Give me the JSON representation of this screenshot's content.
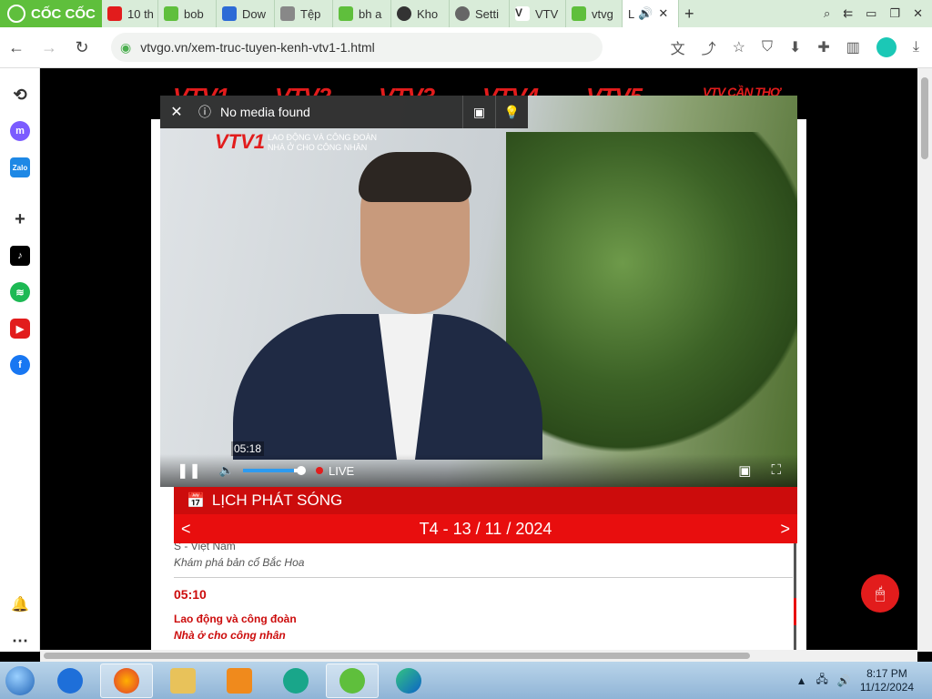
{
  "browser": {
    "name": "CỐC CỐC",
    "tabs": [
      {
        "label": "10 th",
        "icon": "youtube-icon"
      },
      {
        "label": "bob",
        "icon": "coccoc-icon"
      },
      {
        "label": "Dow",
        "icon": "download-icon"
      },
      {
        "label": "Tệp",
        "icon": "file-icon"
      },
      {
        "label": "bh a",
        "icon": "coccoc-icon"
      },
      {
        "label": "Kho",
        "icon": "github-icon"
      },
      {
        "label": "Setti",
        "icon": "gear-icon"
      },
      {
        "label": "VTV",
        "icon": "vtv-icon"
      },
      {
        "label": "vtvg",
        "icon": "coccoc-icon"
      },
      {
        "label": "L",
        "icon": "speaker-icon",
        "active": true
      }
    ],
    "new_tab_label": "+",
    "url": "vtvgo.vn/xem-truc-tuyen-kenh-vtv1-1.html"
  },
  "channels": [
    "VTV1",
    "VTV2",
    "VTV3",
    "VTV4",
    "VTV5",
    "VTV CẦN THƠ"
  ],
  "pip_popup": {
    "message": "No media found"
  },
  "video": {
    "watermark": "VTV1",
    "watermark_line1": "LAO ĐỘNG VÀ CÔNG ĐOÀN",
    "watermark_line2": "NHÀ Ở CHO CÔNG NHÂN",
    "time": "05:18",
    "live_label": "LIVE",
    "volume": 0.85
  },
  "schedule": {
    "title": "LỊCH PHÁT SÓNG",
    "date": "T4 - 13 / 11 / 2024",
    "prev": "<",
    "next": ">",
    "items": [
      {
        "line1": "S - Việt Nam",
        "line2": "Khám phá bản cổ Bắc Hoa"
      },
      {
        "time": "05:10",
        "program": "Lao động và công đoàn",
        "subtitle": "Nhà ở cho công nhân"
      }
    ]
  },
  "taskbar": {
    "time": "8:17 PM",
    "date": "11/12/2024"
  }
}
